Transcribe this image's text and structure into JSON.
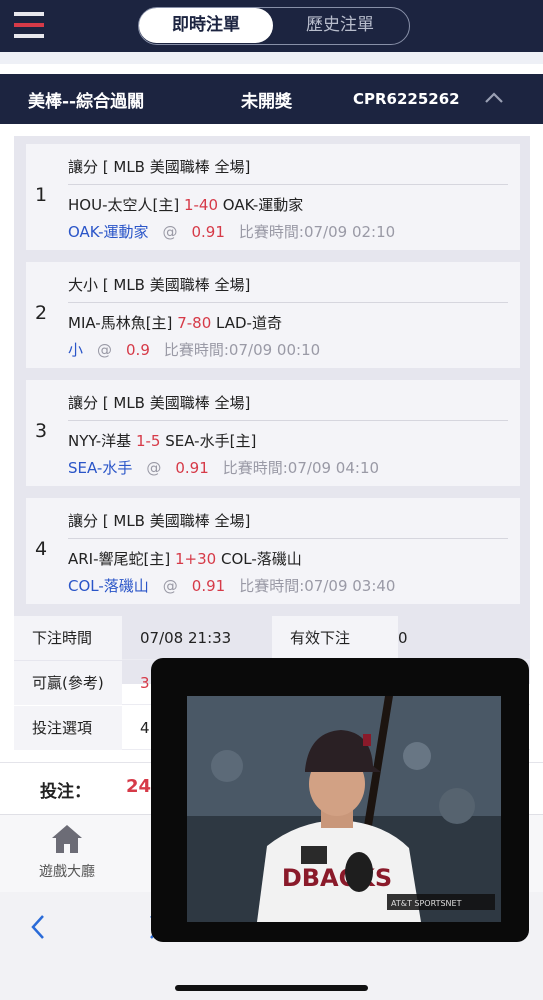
{
  "header": {
    "tabs": [
      {
        "label": "即時注單",
        "active": true
      },
      {
        "label": "歷史注單",
        "active": false
      }
    ]
  },
  "order": {
    "type": "美棒--綜合過關",
    "status": "未開獎",
    "id": "CPR6225262",
    "legs": [
      {
        "num": "1",
        "market": "讓分 [ MLB 美國職棒 全場]",
        "home": "HOU-太空人[主]",
        "handicap": "1-40",
        "away": "OAK-運動家",
        "pick": "OAK-運動家",
        "at": "@",
        "odds": "0.91",
        "time": "比賽時間:07/09 02:10"
      },
      {
        "num": "2",
        "market": "大小 [ MLB 美國職棒 全場]",
        "home": "MIA-馬林魚[主]",
        "handicap": "7-80",
        "away": "LAD-道奇",
        "pick": "小",
        "at": "@",
        "odds": "0.9",
        "time": "比賽時間:07/09 00:10"
      },
      {
        "num": "3",
        "market": "讓分 [ MLB 美國職棒 全場]",
        "home": "NYY-洋基",
        "handicap": "1-5",
        "away": "SEA-水手[主]",
        "pick": "SEA-水手",
        "at": "@",
        "odds": "0.91",
        "time": "比賽時間:07/09 04:10"
      },
      {
        "num": "4",
        "market": "讓分 [ MLB 美國職棒 全場]",
        "home": "ARI-響尾蛇[主]",
        "handicap": "1+30",
        "away": "COL-落磯山",
        "pick": "COL-落磯山",
        "at": "@",
        "odds": "0.91",
        "time": "比賽時間:07/09 03:40"
      }
    ],
    "info": {
      "bet_time_label": "下注時間",
      "bet_time": "07/08 21:33",
      "valid_bet_label": "有效下注",
      "valid_bet": "0",
      "payout_label": "可贏(參考)",
      "payout_partial": "3",
      "option_label": "投注選項",
      "option_partial": "4"
    }
  },
  "summary": {
    "label": "投注：",
    "value_partial": "24"
  },
  "bottom_nav": {
    "lobby_label": "遊戲大廳",
    "lobby_icon": "home-icon"
  },
  "browser": {
    "back_icon": "chevron-left-icon",
    "forward_icon": "chevron-right-icon"
  },
  "pip": {
    "description_icon": "video-player",
    "jersey_text": "DBACKS",
    "network": "AT&T SPORTSNET"
  },
  "colors": {
    "navy": "#1c2440",
    "red": "#d63a48",
    "blue": "#2a55c8",
    "gray_text": "#9a9aa6"
  }
}
